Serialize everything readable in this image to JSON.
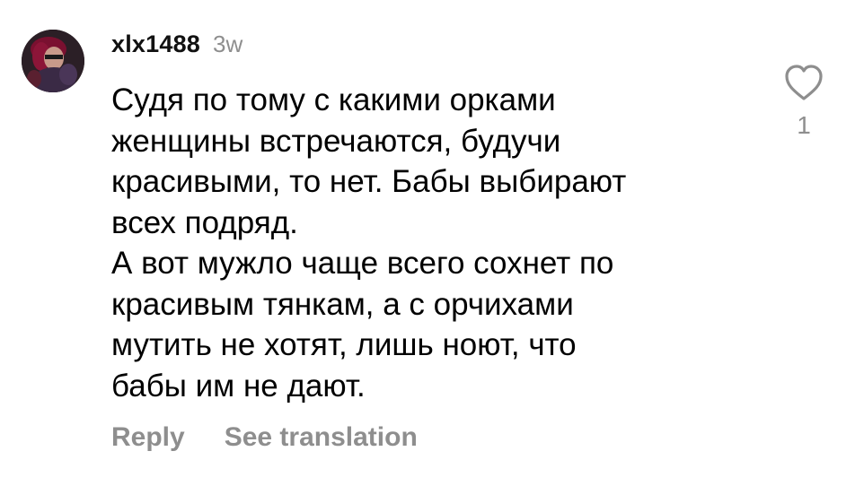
{
  "comment": {
    "username": "xlx1488",
    "time_ago": "3w",
    "text": "Судя по тому с какими орками\nженщины встречаются, будучи\nкрасивыми, то нет. Бабы выбирают\nвсех подряд.\nА вот мужло чаще всего сохнет по\nкрасивым тянкам, а с орчихами\nмутить не хотят, лишь ноют, что\nбабы им не дают.",
    "reply_label": "Reply",
    "translate_label": "See translation",
    "like_count": "1",
    "like_icon": "heart-outline-icon",
    "avatar": "user-avatar"
  },
  "colors": {
    "muted_text": "#8e8e8e",
    "body_text": "#000000",
    "background": "#ffffff"
  }
}
